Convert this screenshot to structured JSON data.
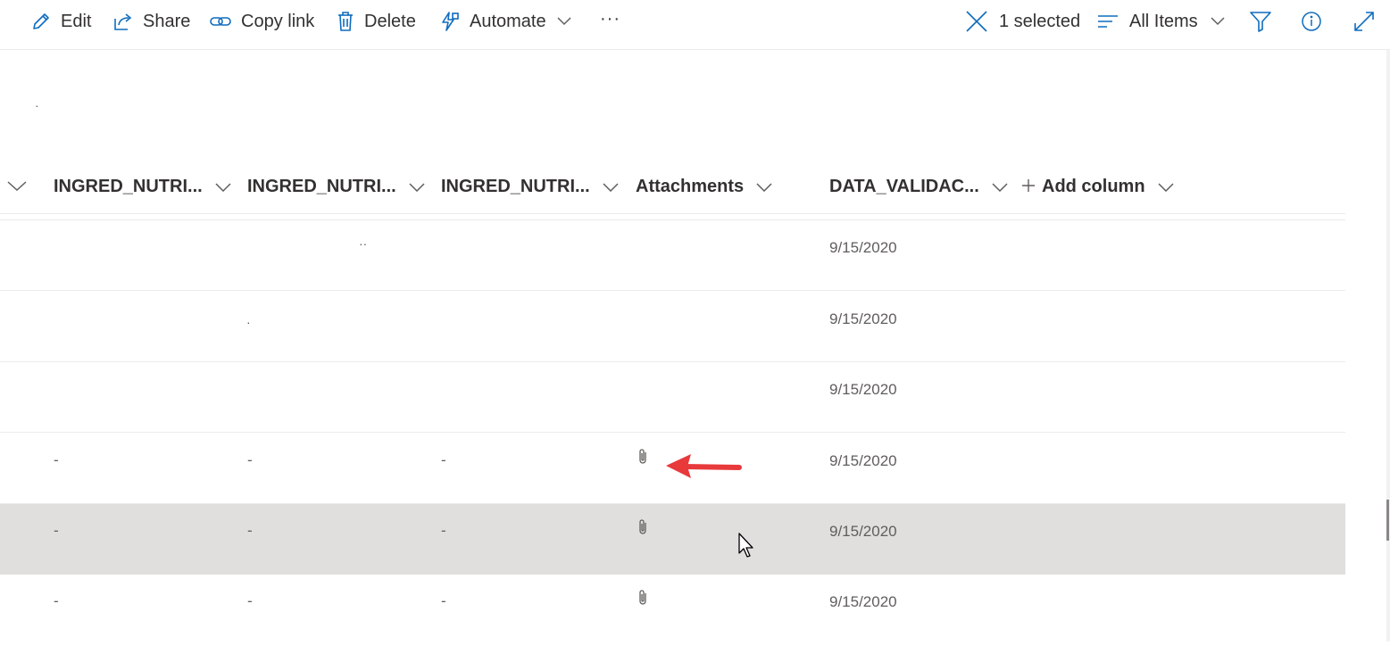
{
  "toolbar": {
    "edit_label": "Edit",
    "share_label": "Share",
    "copy_link_label": "Copy link",
    "delete_label": "Delete",
    "automate_label": "Automate",
    "more_label": "···",
    "selection_label": "1 selected",
    "view_label": "All Items"
  },
  "columns": {
    "col1": "INGRED_NUTRI...",
    "col2": "INGRED_NUTRI...",
    "col3": "INGRED_NUTRI...",
    "attachments": "Attachments",
    "data_validac": "DATA_VALIDAC...",
    "add_column": "Add column"
  },
  "rows": [
    {
      "col1": "",
      "col2": "",
      "col3": "",
      "attachment": false,
      "date": "9/15/2020"
    },
    {
      "col1": "",
      "col2": "",
      "col3": "",
      "attachment": false,
      "date": "9/15/2020"
    },
    {
      "col1": "",
      "col2": "",
      "col3": "",
      "attachment": false,
      "date": "9/15/2020"
    },
    {
      "col1": "-",
      "col2": "-",
      "col3": "-",
      "attachment": true,
      "date": "9/15/2020"
    },
    {
      "col1": "-",
      "col2": "-",
      "col3": "-",
      "attachment": true,
      "date": "9/15/2020",
      "selected": true
    },
    {
      "col1": "-",
      "col2": "-",
      "col3": "-",
      "attachment": true,
      "date": "9/15/2020"
    }
  ],
  "icons": {
    "edit": "pencil-icon",
    "share": "share-icon",
    "copy_link": "link-icon",
    "delete": "trash-icon",
    "automate": "flash-icon",
    "clear_selection": "close-icon",
    "view": "list-icon",
    "filter": "filter-icon",
    "info": "info-icon",
    "expand": "expand-icon",
    "attachment": "paperclip-icon",
    "annotation": "red-arrow-icon",
    "cursor": "mouse-pointer-icon"
  },
  "colors": {
    "accent": "#0f6cbd",
    "selected_row": "#e1dfdd",
    "annotation_arrow": "#e8393b"
  }
}
